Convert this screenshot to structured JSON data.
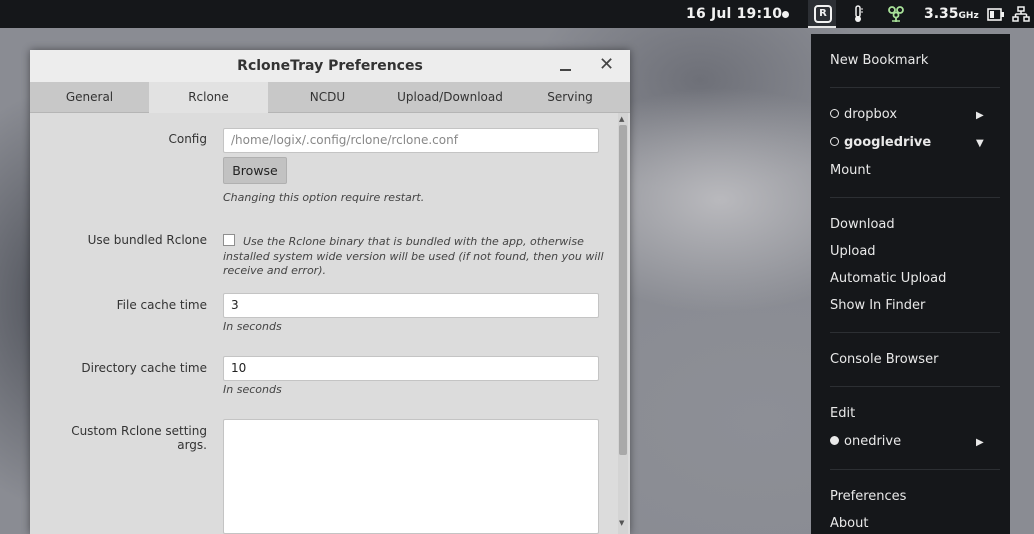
{
  "panel": {
    "clock": "16 Jul  19:10",
    "tray_icon_letter": "R",
    "cpu_value": "3.35",
    "cpu_unit": "GHz"
  },
  "window": {
    "title": "RcloneTray Preferences",
    "tabs": [
      {
        "label": "General"
      },
      {
        "label": "Rclone"
      },
      {
        "label": "NCDU"
      },
      {
        "label": "Upload/Download"
      },
      {
        "label": "Serving"
      }
    ],
    "active_tab": "Rclone",
    "config": {
      "label": "Config",
      "value": "/home/logix/.config/rclone/rclone.conf",
      "browse_label": "Browse",
      "hint": "Changing this option require restart."
    },
    "bundled": {
      "label": "Use bundled Rclone",
      "desc_line1": "Use the Rclone binary that is bundled with the app, otherwise",
      "desc_line2": "installed system wide version will be used (if not found, then you will",
      "desc_line3": "receive and error).",
      "checked": false
    },
    "file_cache": {
      "label": "File cache time",
      "value": "3",
      "hint": "In seconds"
    },
    "dir_cache": {
      "label": "Directory cache time",
      "value": "10",
      "hint": "In seconds"
    },
    "custom_args": {
      "label": "Custom Rclone setting args.",
      "value": ""
    }
  },
  "menu": {
    "new_bookmark": "New Bookmark",
    "dropbox": "dropbox",
    "googledrive": "googledrive",
    "mount": "Mount",
    "download": "Download",
    "upload": "Upload",
    "automatic_upload": "Automatic Upload",
    "show_in_finder": "Show In Finder",
    "console_browser": "Console Browser",
    "edit": "Edit",
    "onedrive": "onedrive",
    "preferences": "Preferences",
    "about": "About"
  },
  "colors": {
    "panel_bg": "#15171a",
    "menu_bg": "#15171a",
    "window_bg": "#dcdcdc",
    "clover_icon": "#a9e29a"
  }
}
